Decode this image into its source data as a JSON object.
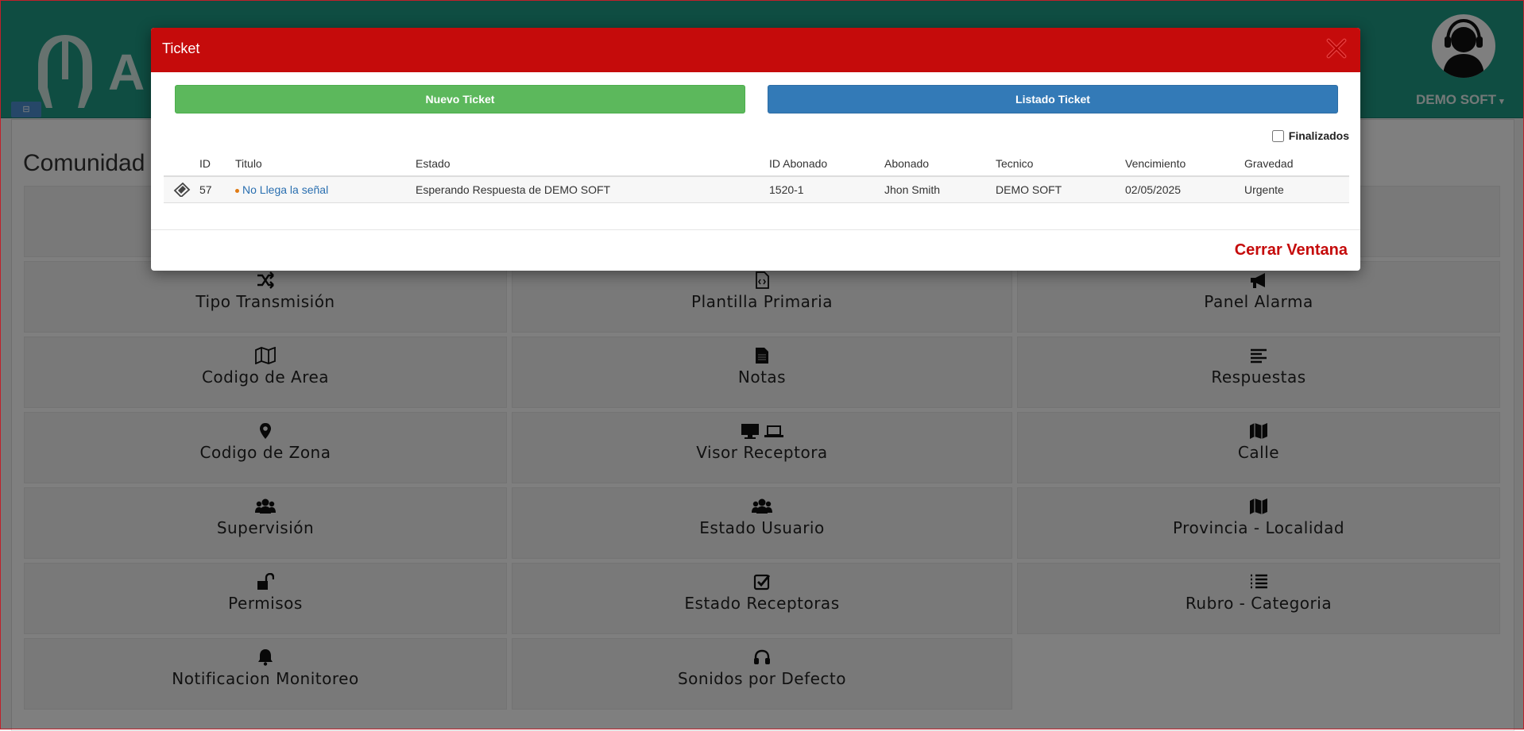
{
  "header": {
    "logo_text": "A",
    "user_name": "DEMO SOFT",
    "sidebar_toggle": "⊟"
  },
  "page": {
    "title": "Comunidad"
  },
  "tiles": [
    {
      "label": "Tipo Transmisión",
      "icon": "random-icon"
    },
    {
      "label": "Plantilla Primaria",
      "icon": "file-code-icon"
    },
    {
      "label": "Panel Alarma",
      "icon": "bullhorn-icon"
    },
    {
      "label": "Codigo de Area",
      "icon": "map-outline-icon"
    },
    {
      "label": "Notas",
      "icon": "file-text-icon"
    },
    {
      "label": "Respuestas",
      "icon": "align-left-icon"
    },
    {
      "label": "Codigo de Zona",
      "icon": "map-marker-icon"
    },
    {
      "label": "Visor Receptora",
      "icon": "desktop-laptop-icon"
    },
    {
      "label": "Calle",
      "icon": "map-icon"
    },
    {
      "label": "Supervisión",
      "icon": "users-icon"
    },
    {
      "label": "Estado Usuario",
      "icon": "users-icon"
    },
    {
      "label": "Provincia - Localidad",
      "icon": "map-icon"
    },
    {
      "label": "Permisos",
      "icon": "unlock-icon"
    },
    {
      "label": "Estado Receptoras",
      "icon": "check-square-icon"
    },
    {
      "label": "Rubro - Categoria",
      "icon": "list-icon"
    },
    {
      "label": "Notificacion Monitoreo",
      "icon": "bell-icon"
    },
    {
      "label": "Sonidos por Defecto",
      "icon": "headphones-icon"
    }
  ],
  "modal": {
    "title": "Ticket",
    "new_ticket": "Nuevo Ticket",
    "list_ticket": "Listado Ticket",
    "finalizados_label": "Finalizados",
    "finalizados_checked": false,
    "columns": [
      "ID",
      "Titulo",
      "Estado",
      "ID Abonado",
      "Abonado",
      "Tecnico",
      "Vencimiento",
      "Gravedad"
    ],
    "rows": [
      {
        "id": "57",
        "titulo": "No Llega la señal",
        "estado": "Esperando Respuesta de DEMO SOFT",
        "id_abonado": "1520-1",
        "abonado": "Jhon Smith",
        "tecnico": "DEMO SOFT",
        "vencimiento": "02/05/2025",
        "gravedad": "Urgente"
      }
    ],
    "close_label": "Cerrar Ventana"
  },
  "colors": {
    "header": "#1f9a85",
    "modal_header": "#c50b0b",
    "btn_green": "#5cb85c",
    "btn_blue": "#337ab7",
    "link": "#2a6fb0",
    "dot": "#e07b14"
  }
}
